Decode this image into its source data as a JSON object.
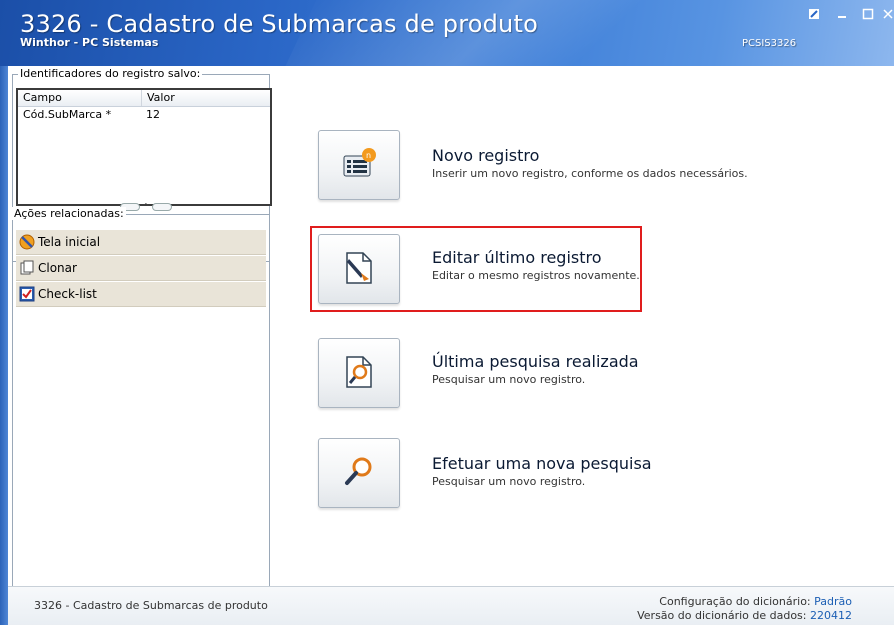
{
  "window": {
    "title": "3326 - Cadastro de Submarcas de produto",
    "subtitle": "Winthor - PC Sistemas",
    "program_code": "PCSIS3326"
  },
  "left_panel": {
    "identifiers": {
      "title": "Identificadores do registro salvo:",
      "columns": [
        "Campo",
        "Valor"
      ],
      "rows": [
        {
          "campo": "Cód.SubMarca *",
          "valor": "12"
        }
      ]
    },
    "actions": {
      "title": "Ações relacionadas:",
      "items": [
        {
          "label": "Tela inicial",
          "icon": "home-icon"
        },
        {
          "label": "Clonar",
          "icon": "clone-icon"
        },
        {
          "label": "Check-list",
          "icon": "checklist-icon"
        }
      ]
    }
  },
  "options": [
    {
      "title": "Novo registro",
      "desc": "Inserir um novo registro, conforme os dados necessários.",
      "icon": "new-record-icon"
    },
    {
      "title": "Editar último registro",
      "desc": "Editar o mesmo registros novamente.",
      "icon": "edit-record-icon",
      "highlighted": true
    },
    {
      "title": "Última pesquisa realizada",
      "desc": "Pesquisar um novo registro.",
      "icon": "last-search-icon"
    },
    {
      "title": "Efetuar uma nova pesquisa",
      "desc": "Pesquisar um novo registro.",
      "icon": "new-search-icon"
    }
  ],
  "statusbar": {
    "left": "3326 - Cadastro de Submarcas de produto",
    "config_label": "Configuração do dicionário:",
    "config_value": "Padrão",
    "version_label": "Versão do dicionário de dados:",
    "version_value": "220412"
  },
  "colors": {
    "highlight": "#e01d1d",
    "link_value": "#1c5fb4",
    "titlebar": "#2a66c6"
  }
}
